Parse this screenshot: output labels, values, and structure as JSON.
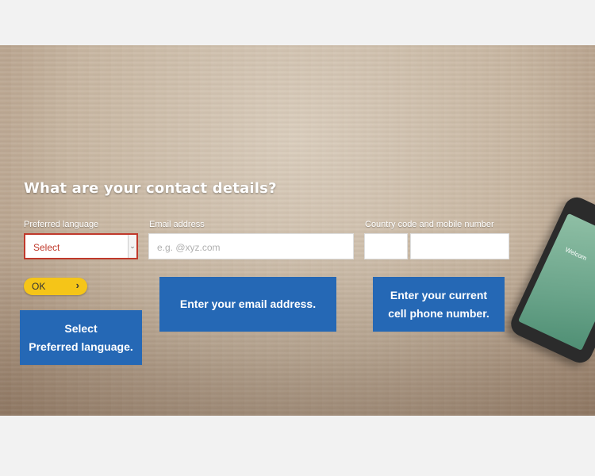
{
  "form": {
    "title": "What are your contact details?",
    "language": {
      "label": "Preferred language",
      "selected": "Select"
    },
    "email": {
      "label": "Email address",
      "placeholder": "e.g. @xyz.com"
    },
    "phone": {
      "label": "Country code and mobile number"
    },
    "ok_button": {
      "label": "OK",
      "icon": "chevron-right-icon"
    }
  },
  "tooltips": {
    "language": [
      "Select",
      "Preferred language."
    ],
    "email": "Enter your email address.",
    "phone": [
      "Enter your current",
      "cell phone number."
    ]
  },
  "phone_image": {
    "screen_text": "Welcom"
  },
  "colors": {
    "tooltip_bg": "#2568b5",
    "ok_button": "#f5c518",
    "select_border": "#c0392b",
    "page_bg": "#f2f2f2"
  }
}
